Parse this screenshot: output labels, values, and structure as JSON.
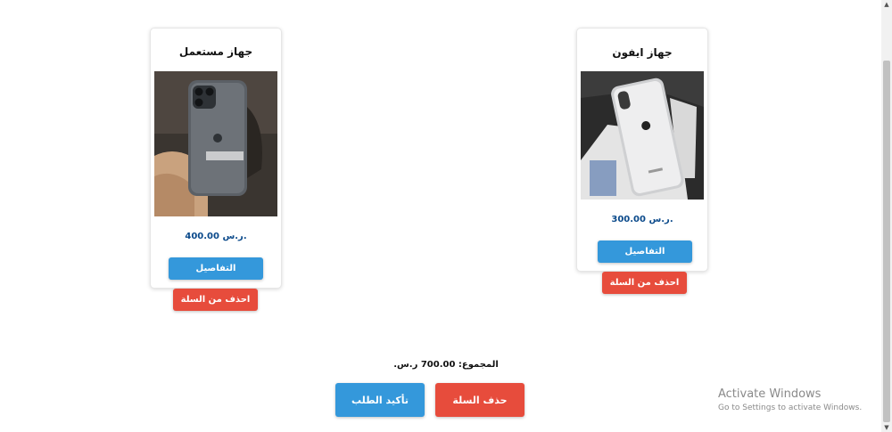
{
  "products": [
    {
      "name": "جهاز مستعمل",
      "price": "400.00 ر.س.",
      "details_label": "التفاصيل",
      "remove_label": "احذف من السلة"
    },
    {
      "name": "جهاز ايفون",
      "price": "300.00 ر.س.",
      "details_label": "التفاصيل",
      "remove_label": "احذف من السلة"
    }
  ],
  "total": {
    "label": "المجموع:",
    "value": "700.00 ر.س."
  },
  "actions": {
    "clear_cart_label": "حذف السلة",
    "confirm_order_label": "تأكيد الطلب"
  },
  "watermark": {
    "title": "Activate Windows",
    "subtitle": "Go to Settings to activate Windows."
  },
  "colors": {
    "primary_blue": "#3498db",
    "danger_red": "#e74c3c",
    "price_blue": "#0b4a8b"
  }
}
